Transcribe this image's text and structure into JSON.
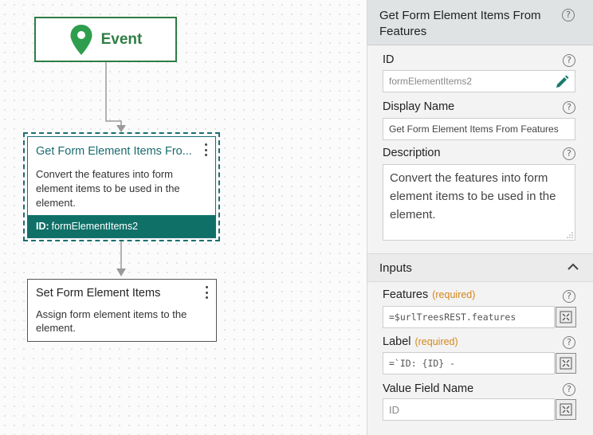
{
  "canvas": {
    "event_node": {
      "label": "Event"
    },
    "step_node": {
      "title": "Get Form Element Items Fro...",
      "description": "Convert the features into form element items to be used in the element.",
      "id_label": "ID:",
      "id_value": "formElementItems2"
    },
    "next_node": {
      "title": "Set Form Element Items",
      "description": "Assign form element items to the element."
    },
    "colors": {
      "event_green": "#2e7d44",
      "selected_teal": "#0f7068"
    }
  },
  "panel": {
    "title": "Get Form Element Items From Features",
    "help_glyph": "?",
    "id": {
      "label": "ID",
      "value": "formElementItems2"
    },
    "display_name": {
      "label": "Display Name",
      "value": "Get Form Element Items From Features"
    },
    "description": {
      "label": "Description",
      "value": "Convert the features into form element items to be used in the element."
    },
    "inputs_section": {
      "title": "Inputs",
      "fields": [
        {
          "label": "Features",
          "required": "(required)",
          "value": "=$urlTreesREST.features"
        },
        {
          "label": "Label",
          "required": "(required)",
          "value": "=`ID: {ID} -"
        },
        {
          "label": "Value Field Name",
          "required": "",
          "value": "ID"
        }
      ]
    },
    "icons": {
      "edit": "pencil-icon",
      "expression": "expression-editor-icon",
      "collapse": "chevron-up-icon",
      "help": "help-icon"
    }
  }
}
